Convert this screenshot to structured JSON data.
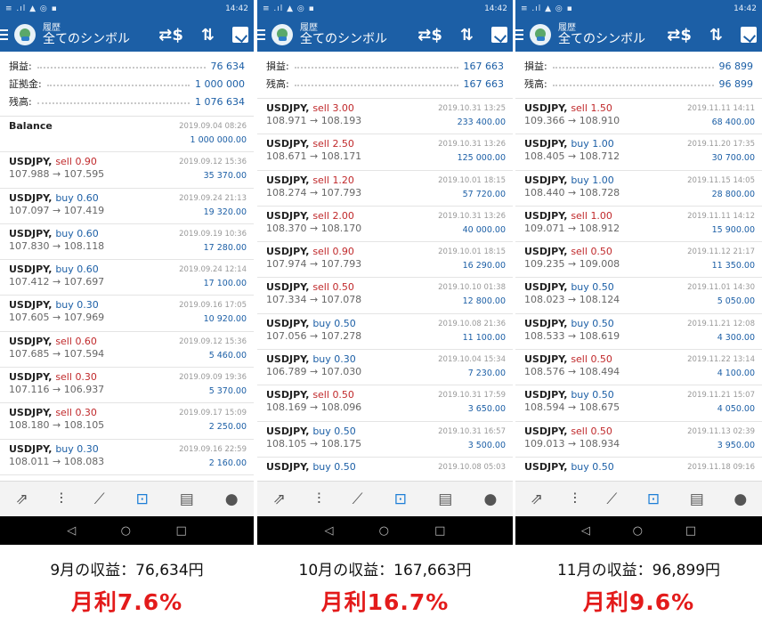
{
  "status": {
    "time": "14:42",
    "left": "≡ .ıl ▲ ◎ ▪",
    "right": "☾ ◔ ⏰ ▯ ⟟"
  },
  "appbar": {
    "subtitle": "履歴",
    "title": "全てのシンボル",
    "icons": [
      "menu-icon",
      "logo-icon",
      "dollar-swap-icon",
      "sort-icon",
      "calendar-icon"
    ]
  },
  "nav_icons": [
    "quotes-icon",
    "chart-icon",
    "trade-icon",
    "history-icon",
    "news-icon",
    "chat-icon"
  ],
  "sys_icons": [
    "back-icon",
    "home-icon",
    "recents-icon"
  ],
  "sys_glyphs": {
    "back": "◁",
    "home": "○",
    "recent": "□"
  },
  "nav_glyphs": {
    "quotes": "⇗",
    "chart": "⫶",
    "trade": "⟋",
    "history": "⊡",
    "news": "▤",
    "chat": "●"
  },
  "phones": [
    {
      "summary": [
        {
          "label": "損益:",
          "value": "76 634"
        },
        {
          "label": "証拠金:",
          "value": "1 000 000"
        },
        {
          "label": "残高:",
          "value": "1 076 634"
        }
      ],
      "balance": {
        "label": "Balance",
        "date": "2019.09.04 08:26",
        "amount": "1 000 000.00"
      },
      "trades": [
        {
          "symbol": "USDJPY,",
          "side": "sell",
          "lot": "0.90",
          "price": "107.988 → 107.595",
          "date": "2019.09.12 15:36",
          "profit": "35 370.00"
        },
        {
          "symbol": "USDJPY,",
          "side": "buy",
          "lot": "0.60",
          "price": "107.097 → 107.419",
          "date": "2019.09.24 21:13",
          "profit": "19 320.00"
        },
        {
          "symbol": "USDJPY,",
          "side": "buy",
          "lot": "0.60",
          "price": "107.830 → 108.118",
          "date": "2019.09.19 10:36",
          "profit": "17 280.00"
        },
        {
          "symbol": "USDJPY,",
          "side": "buy",
          "lot": "0.60",
          "price": "107.412 → 107.697",
          "date": "2019.09.24 12:14",
          "profit": "17 100.00"
        },
        {
          "symbol": "USDJPY,",
          "side": "buy",
          "lot": "0.30",
          "price": "107.605 → 107.969",
          "date": "2019.09.16 17:05",
          "profit": "10 920.00"
        },
        {
          "symbol": "USDJPY,",
          "side": "sell",
          "lot": "0.60",
          "price": "107.685 → 107.594",
          "date": "2019.09.12 15:36",
          "profit": "5 460.00"
        },
        {
          "symbol": "USDJPY,",
          "side": "sell",
          "lot": "0.30",
          "price": "107.116 → 106.937",
          "date": "2019.09.09 19:36",
          "profit": "5 370.00"
        },
        {
          "symbol": "USDJPY,",
          "side": "sell",
          "lot": "0.30",
          "price": "108.180 → 108.105",
          "date": "2019.09.17 15:09",
          "profit": "2 250.00"
        },
        {
          "symbol": "USDJPY,",
          "side": "buy",
          "lot": "0.30",
          "price": "108.011 → 108.083",
          "date": "2019.09.16 22:59",
          "profit": "2 160.00"
        }
      ],
      "caption": {
        "income": "9月の収益：76,634円",
        "rate": "月利7.6%"
      }
    },
    {
      "summary": [
        {
          "label": "損益:",
          "value": "167 663"
        },
        {
          "label": "残高:",
          "value": "167 663"
        }
      ],
      "trades": [
        {
          "symbol": "USDJPY,",
          "side": "sell",
          "lot": "3.00",
          "price": "108.971 → 108.193",
          "date": "2019.10.31 13:25",
          "profit": "233 400.00"
        },
        {
          "symbol": "USDJPY,",
          "side": "sell",
          "lot": "2.50",
          "price": "108.671 → 108.171",
          "date": "2019.10.31 13:26",
          "profit": "125 000.00"
        },
        {
          "symbol": "USDJPY,",
          "side": "sell",
          "lot": "1.20",
          "price": "108.274 → 107.793",
          "date": "2019.10.01 18:15",
          "profit": "57 720.00"
        },
        {
          "symbol": "USDJPY,",
          "side": "sell",
          "lot": "2.00",
          "price": "108.370 → 108.170",
          "date": "2019.10.31 13:26",
          "profit": "40 000.00"
        },
        {
          "symbol": "USDJPY,",
          "side": "sell",
          "lot": "0.90",
          "price": "107.974 → 107.793",
          "date": "2019.10.01 18:15",
          "profit": "16 290.00"
        },
        {
          "symbol": "USDJPY,",
          "side": "sell",
          "lot": "0.50",
          "price": "107.334 → 107.078",
          "date": "2019.10.10 01:38",
          "profit": "12 800.00"
        },
        {
          "symbol": "USDJPY,",
          "side": "buy",
          "lot": "0.50",
          "price": "107.056 → 107.278",
          "date": "2019.10.08 21:36",
          "profit": "11 100.00"
        },
        {
          "symbol": "USDJPY,",
          "side": "buy",
          "lot": "0.30",
          "price": "106.789 → 107.030",
          "date": "2019.10.04 15:34",
          "profit": "7 230.00"
        },
        {
          "symbol": "USDJPY,",
          "side": "sell",
          "lot": "0.50",
          "price": "108.169 → 108.096",
          "date": "2019.10.31 17:59",
          "profit": "3 650.00"
        },
        {
          "symbol": "USDJPY,",
          "side": "buy",
          "lot": "0.50",
          "price": "108.105 → 108.175",
          "date": "2019.10.31 16:57",
          "profit": "3 500.00"
        },
        {
          "symbol": "USDJPY,",
          "side": "buy",
          "lot": "0.50",
          "price": "",
          "date": "2019.10.08 05:03",
          "profit": ""
        }
      ],
      "caption": {
        "income": "10月の収益：167,663円",
        "rate": "月利16.7%"
      }
    },
    {
      "summary": [
        {
          "label": "損益:",
          "value": "96 899"
        },
        {
          "label": "残高:",
          "value": "96 899"
        }
      ],
      "trades": [
        {
          "symbol": "USDJPY,",
          "side": "sell",
          "lot": "1.50",
          "price": "109.366 → 108.910",
          "date": "2019.11.11 14:11",
          "profit": "68 400.00"
        },
        {
          "symbol": "USDJPY,",
          "side": "buy",
          "lot": "1.00",
          "price": "108.405 → 108.712",
          "date": "2019.11.20 17:35",
          "profit": "30 700.00"
        },
        {
          "symbol": "USDJPY,",
          "side": "buy",
          "lot": "1.00",
          "price": "108.440 → 108.728",
          "date": "2019.11.15 14:05",
          "profit": "28 800.00"
        },
        {
          "symbol": "USDJPY,",
          "side": "sell",
          "lot": "1.00",
          "price": "109.071 → 108.912",
          "date": "2019.11.11 14:12",
          "profit": "15 900.00"
        },
        {
          "symbol": "USDJPY,",
          "side": "sell",
          "lot": "0.50",
          "price": "109.235 → 109.008",
          "date": "2019.11.12 21:17",
          "profit": "11 350.00"
        },
        {
          "symbol": "USDJPY,",
          "side": "buy",
          "lot": "0.50",
          "price": "108.023 → 108.124",
          "date": "2019.11.01 14:30",
          "profit": "5 050.00"
        },
        {
          "symbol": "USDJPY,",
          "side": "buy",
          "lot": "0.50",
          "price": "108.533 → 108.619",
          "date": "2019.11.21 12:08",
          "profit": "4 300.00"
        },
        {
          "symbol": "USDJPY,",
          "side": "sell",
          "lot": "0.50",
          "price": "108.576 → 108.494",
          "date": "2019.11.22 13:14",
          "profit": "4 100.00"
        },
        {
          "symbol": "USDJPY,",
          "side": "buy",
          "lot": "0.50",
          "price": "108.594 → 108.675",
          "date": "2019.11.21 15:07",
          "profit": "4 050.00"
        },
        {
          "symbol": "USDJPY,",
          "side": "sell",
          "lot": "0.50",
          "price": "109.013 → 108.934",
          "date": "2019.11.13 02:39",
          "profit": "3 950.00"
        },
        {
          "symbol": "USDJPY,",
          "side": "buy",
          "lot": "0.50",
          "price": "",
          "date": "2019.11.18 09:16",
          "profit": ""
        }
      ],
      "caption": {
        "income": "11月の収益：96,899円",
        "rate": "月利9.6%"
      }
    }
  ]
}
